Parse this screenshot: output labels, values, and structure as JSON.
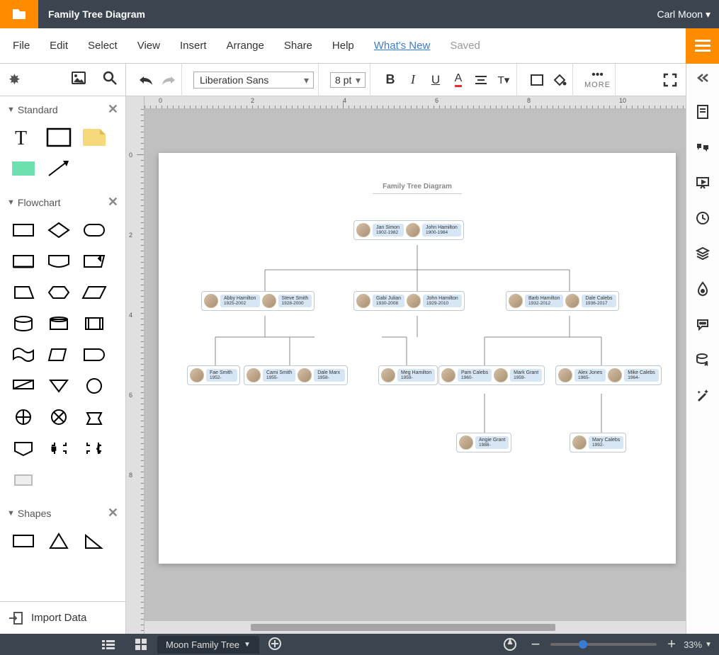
{
  "header": {
    "doc_title": "Family Tree Diagram",
    "user": "Carl Moon ▾"
  },
  "menu": {
    "items": [
      "File",
      "Edit",
      "Select",
      "View",
      "Insert",
      "Arrange",
      "Share",
      "Help"
    ],
    "whats_new": "What's New",
    "saved": "Saved"
  },
  "toolbar": {
    "font": "Liberation Sans",
    "font_size": "8 pt",
    "more": "MORE"
  },
  "shapes": {
    "standard_title": "Standard",
    "flowchart_title": "Flowchart",
    "shapes_title": "Shapes",
    "import": "Import Data"
  },
  "page": {
    "title": "Family Tree Diagram",
    "people": {
      "g1a": {
        "name": "Jan Simon",
        "years": "1902-1982"
      },
      "g1b": {
        "name": "John Hamilton",
        "years": "1900-1984"
      },
      "g2a1": {
        "name": "Abby Hamilton",
        "years": "1925-2002"
      },
      "g2a2": {
        "name": "Steve Smith",
        "years": "1928-2000"
      },
      "g2b1": {
        "name": "Gabi Julian",
        "years": "1930-2008"
      },
      "g2b2": {
        "name": "John Hamilton",
        "years": "1929-2010"
      },
      "g2c1": {
        "name": "Barb Hamilton",
        "years": "1932-2012"
      },
      "g2c2": {
        "name": "Dale Calebs",
        "years": "1936-2017"
      },
      "g3a": {
        "name": "Fae Smith",
        "years": "1952-"
      },
      "g3b": {
        "name": "Cami Smith",
        "years": "1955-"
      },
      "g3c": {
        "name": "Dale Marx",
        "years": "1958-"
      },
      "g3d": {
        "name": "Meg Hamilton",
        "years": "1959-"
      },
      "g3e1": {
        "name": "Pam Calebs",
        "years": "1960-"
      },
      "g3e2": {
        "name": "Mark Grant",
        "years": "1959-"
      },
      "g3f1": {
        "name": "Alex Jones",
        "years": "1965-"
      },
      "g3f2": {
        "name": "Mike Calebs",
        "years": "1964-"
      },
      "g4a": {
        "name": "Angie Grant",
        "years": "1988-"
      },
      "g4b": {
        "name": "Mary Calebs",
        "years": "1992-"
      }
    }
  },
  "bottom": {
    "tab": "Moon Family Tree",
    "zoom": "33%"
  },
  "ruler_marks": [
    "0",
    "2",
    "4",
    "6",
    "8",
    "10"
  ]
}
